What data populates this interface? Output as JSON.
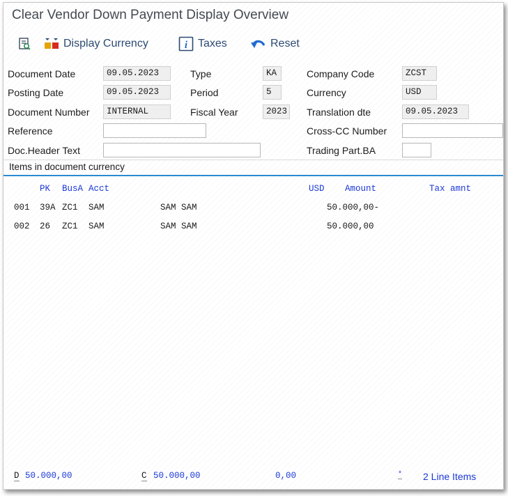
{
  "title": "Clear Vendor Down Payment Display Overview",
  "toolbar": {
    "display_currency": "Display Currency",
    "taxes": "Taxes",
    "reset": "Reset"
  },
  "header": {
    "document_date": {
      "label": "Document Date",
      "value": "09.05.2023"
    },
    "posting_date": {
      "label": "Posting Date",
      "value": "09.05.2023"
    },
    "document_number": {
      "label": "Document Number",
      "value": "INTERNAL"
    },
    "reference": {
      "label": "Reference",
      "value": ""
    },
    "doc_header_text": {
      "label": "Doc.Header Text",
      "value": ""
    },
    "type": {
      "label": "Type",
      "value": "KA"
    },
    "period": {
      "label": "Period",
      "value": "5"
    },
    "fiscal_year": {
      "label": "Fiscal Year",
      "value": "2023"
    },
    "company_code": {
      "label": "Company Code",
      "value": "ZCST"
    },
    "currency": {
      "label": "Currency",
      "value": "USD"
    },
    "translation_dte": {
      "label": "Translation dte",
      "value": "09.05.2023"
    },
    "cross_cc_number": {
      "label": "Cross-CC Number",
      "value": ""
    },
    "trading_part_ba": {
      "label": "Trading Part.BA",
      "value": ""
    }
  },
  "items": {
    "section_title": "Items in document currency",
    "columns": {
      "pk": "PK",
      "busa": "BusA",
      "acct": "Acct",
      "currency": "USD",
      "amount": "Amount",
      "tax": "Tax amnt"
    },
    "rows": [
      {
        "no": "001",
        "pk": "39A",
        "busa": "ZC1",
        "acct": "SAM",
        "name": "SAM SAM",
        "amount": "50.000,00-"
      },
      {
        "no": "002",
        "pk": "26",
        "busa": "ZC1",
        "acct": "SAM",
        "name": "SAM SAM",
        "amount": "50.000,00"
      }
    ]
  },
  "footer": {
    "debit_label": "D",
    "debit_value": "50.000,00",
    "credit_label": "C",
    "credit_value": "50.000,00",
    "balance": "0,00",
    "star": "*",
    "line_items": "2 Line Items"
  }
}
